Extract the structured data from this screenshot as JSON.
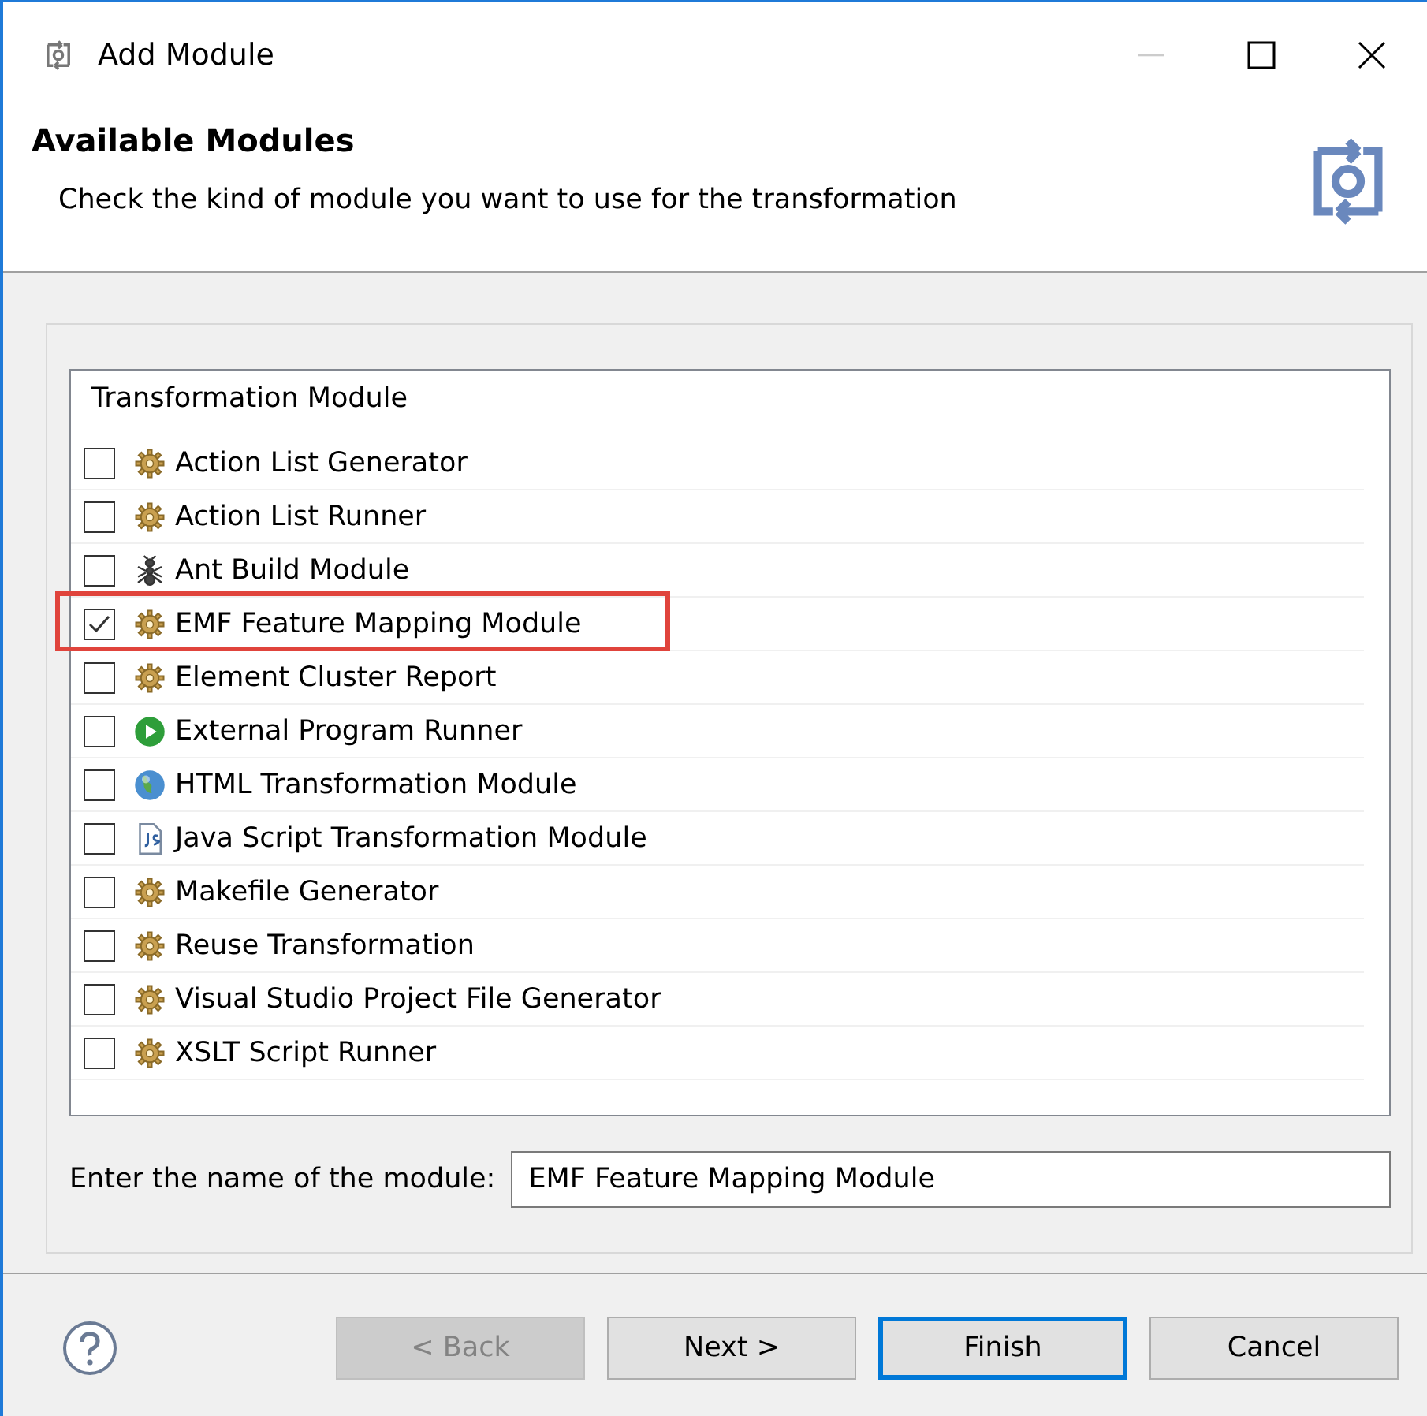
{
  "window": {
    "title": "Add Module"
  },
  "header": {
    "title": "Available Modules",
    "description": "Check the kind of module you want to use for the transformation"
  },
  "list": {
    "column": "Transformation Module",
    "items": [
      {
        "label": "Action List Generator",
        "kind": "gear",
        "checked": false,
        "highlighted": false
      },
      {
        "label": "Action List Runner",
        "kind": "gear",
        "checked": false,
        "highlighted": false
      },
      {
        "label": "Ant Build Module",
        "kind": "ant",
        "checked": false,
        "highlighted": false
      },
      {
        "label": "EMF Feature Mapping Module",
        "kind": "gear",
        "checked": true,
        "highlighted": true
      },
      {
        "label": "Element Cluster Report",
        "kind": "gear",
        "checked": false,
        "highlighted": false
      },
      {
        "label": "External Program Runner",
        "kind": "play",
        "checked": false,
        "highlighted": false
      },
      {
        "label": "HTML Transformation Module",
        "kind": "globe",
        "checked": false,
        "highlighted": false
      },
      {
        "label": "Java Script Transformation Module",
        "kind": "js",
        "checked": false,
        "highlighted": false
      },
      {
        "label": "Makefile Generator",
        "kind": "gear",
        "checked": false,
        "highlighted": false
      },
      {
        "label": "Reuse Transformation",
        "kind": "gear",
        "checked": false,
        "highlighted": false
      },
      {
        "label": "Visual Studio Project File Generator",
        "kind": "gear",
        "checked": false,
        "highlighted": false
      },
      {
        "label": "XSLT Script Runner",
        "kind": "gear",
        "checked": false,
        "highlighted": false
      }
    ]
  },
  "name_field": {
    "label": "Enter the name of the module:",
    "value": "EMF Feature Mapping Module"
  },
  "buttons": [
    {
      "label": "< Back",
      "disabled": true,
      "default": false
    },
    {
      "label": "Next >",
      "disabled": false,
      "default": false
    },
    {
      "label": "Finish",
      "disabled": false,
      "default": true
    },
    {
      "label": "Cancel",
      "disabled": false,
      "default": false
    }
  ]
}
